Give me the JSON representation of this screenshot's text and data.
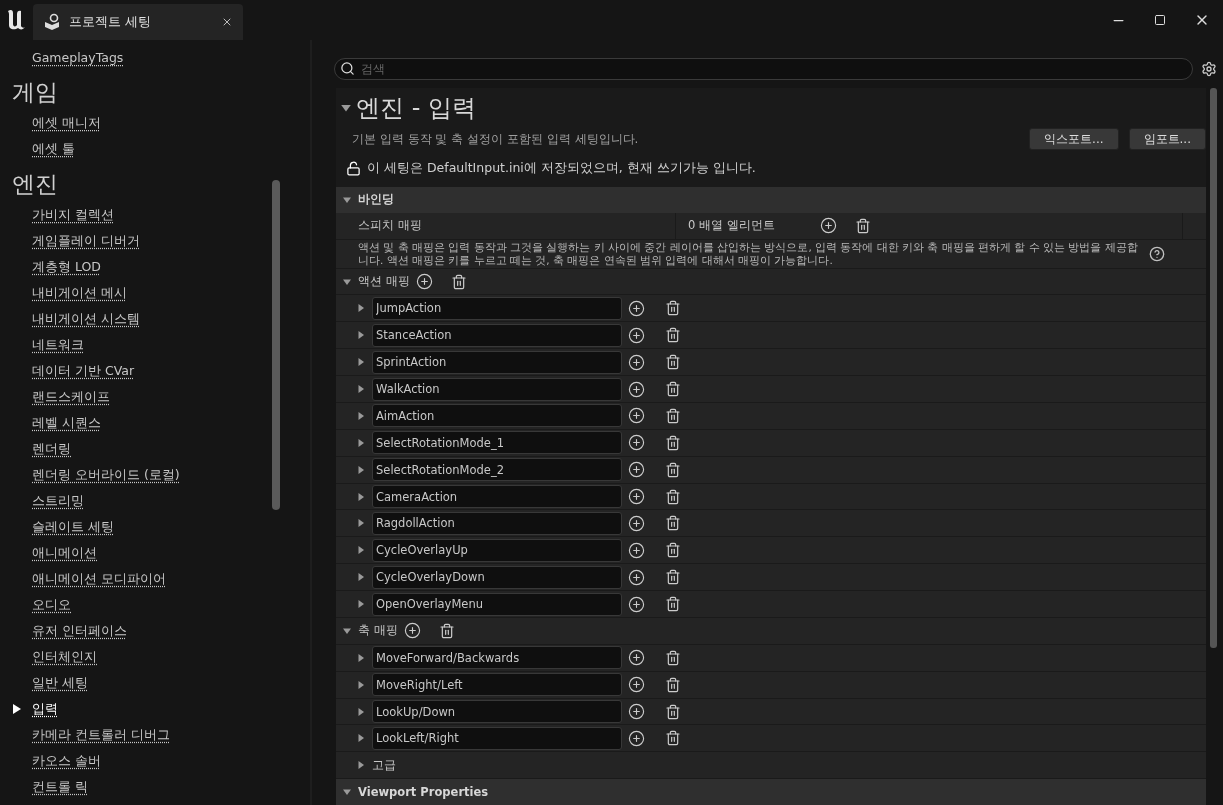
{
  "window": {
    "title": "프로젝트 세팅"
  },
  "sidebar": {
    "items": [
      {
        "kind": "link",
        "label": "GameplayTags",
        "selected": false
      },
      {
        "kind": "heading",
        "label": "게임"
      },
      {
        "kind": "link",
        "label": "에셋 매니저",
        "selected": false
      },
      {
        "kind": "link",
        "label": "에셋 툴",
        "selected": false
      },
      {
        "kind": "heading",
        "label": "엔진"
      },
      {
        "kind": "link",
        "label": "가비지 컬렉션",
        "selected": false
      },
      {
        "kind": "link",
        "label": "게임플레이 디버거",
        "selected": false
      },
      {
        "kind": "link",
        "label": "계층형 LOD",
        "selected": false
      },
      {
        "kind": "link",
        "label": "내비게이션 메시",
        "selected": false
      },
      {
        "kind": "link",
        "label": "내비게이션 시스템",
        "selected": false
      },
      {
        "kind": "link",
        "label": "네트워크",
        "selected": false
      },
      {
        "kind": "link",
        "label": "데이터 기반 CVar",
        "selected": false
      },
      {
        "kind": "link",
        "label": "랜드스케이프",
        "selected": false
      },
      {
        "kind": "link",
        "label": "레벨 시퀀스",
        "selected": false
      },
      {
        "kind": "link",
        "label": "렌더링",
        "selected": false
      },
      {
        "kind": "link",
        "label": "렌더링 오버라이드 (로컬)",
        "selected": false
      },
      {
        "kind": "link",
        "label": "스트리밍",
        "selected": false
      },
      {
        "kind": "link",
        "label": "슬레이트 세팅",
        "selected": false
      },
      {
        "kind": "link",
        "label": "애니메이션",
        "selected": false
      },
      {
        "kind": "link",
        "label": "애니메이션 모디파이어",
        "selected": false
      },
      {
        "kind": "link",
        "label": "오디오",
        "selected": false
      },
      {
        "kind": "link",
        "label": "유저 인터페이스",
        "selected": false
      },
      {
        "kind": "link",
        "label": "인터체인지",
        "selected": false
      },
      {
        "kind": "link",
        "label": "일반 세팅",
        "selected": false
      },
      {
        "kind": "link",
        "label": "입력",
        "selected": true
      },
      {
        "kind": "link",
        "label": "카메라 컨트롤러 디버그",
        "selected": false
      },
      {
        "kind": "link",
        "label": "카오스 솔버",
        "selected": false
      },
      {
        "kind": "link",
        "label": "컨트롤 릭",
        "selected": false
      }
    ]
  },
  "search": {
    "placeholder": "검색"
  },
  "section": {
    "title": "엔진 - 입력",
    "expanded": true,
    "description": "기본 입력 동작 및 축 설정이 포함된 입력 세팅입니다.",
    "buttons": [
      "익스포트...",
      "임포트..."
    ],
    "notice": "이 세팅은 DefaultInput.ini에 저장되었으며, 현재 쓰기가능 입니다.",
    "locked": false
  },
  "binding": {
    "title": "바인딩",
    "expanded": true,
    "speech_mapping": {
      "label": "스피치 매핑",
      "value": "0 배열 엘리먼트"
    },
    "help": "액션 및 축 매핑은 입력 동작과 그것을 실행하는 키 사이에 중간 레이어를 삽입하는 방식으로, 입력 동작에 대한 키와 축 매핑을 편하게 할 수 있는 방법을 제공합니다. 액션 매핑은 키를 누르고 떼는 것, 축 매핑은 연속된 범위 입력에 대해서 매핑이 가능합니다.",
    "action_mappings": {
      "label": "액션 매핑",
      "expanded": true,
      "items": [
        {
          "name": "JumpAction",
          "expanded": false
        },
        {
          "name": "StanceAction",
          "expanded": false
        },
        {
          "name": "SprintAction",
          "expanded": false
        },
        {
          "name": "WalkAction",
          "expanded": false
        },
        {
          "name": "AimAction",
          "expanded": false
        },
        {
          "name": "SelectRotationMode_1",
          "expanded": false
        },
        {
          "name": "SelectRotationMode_2",
          "expanded": false
        },
        {
          "name": "CameraAction",
          "expanded": false
        },
        {
          "name": "RagdollAction",
          "expanded": false
        },
        {
          "name": "CycleOverlayUp",
          "expanded": false
        },
        {
          "name": "CycleOverlayDown",
          "expanded": false
        },
        {
          "name": "OpenOverlayMenu",
          "expanded": false
        }
      ]
    },
    "axis_mappings": {
      "label": "축 매핑",
      "expanded": true,
      "items": [
        {
          "name": "MoveForward/Backwards",
          "expanded": false
        },
        {
          "name": "MoveRight/Left",
          "expanded": false
        },
        {
          "name": "LookUp/Down",
          "expanded": false
        },
        {
          "name": "LookLeft/Right",
          "expanded": false
        }
      ]
    },
    "advanced": {
      "label": "고급",
      "expanded": false
    }
  },
  "viewport": {
    "title": "Viewport Properties",
    "expanded": true
  }
}
